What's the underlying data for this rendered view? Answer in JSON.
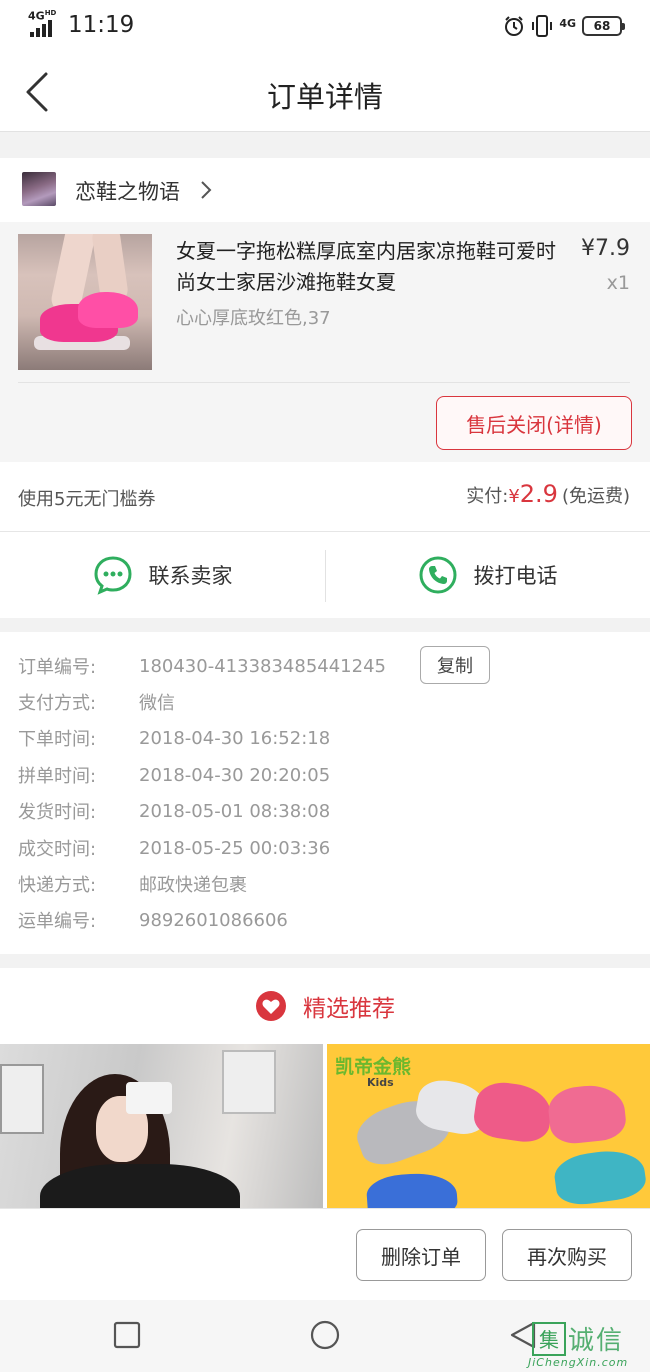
{
  "status_bar": {
    "network": "4G",
    "network_hd": "HD",
    "time": "11:19",
    "network_right": "4G",
    "battery": "68"
  },
  "nav": {
    "title": "订单详情"
  },
  "shop": {
    "name": "恋鞋之物语"
  },
  "product": {
    "title": "女夏一字拖松糕厚底室内居家凉拖鞋可爱时尚女士家居沙滩拖鞋女夏",
    "price": "¥7.9",
    "quantity": "x1",
    "spec": "心心厚底玫红色,37",
    "after_sale_label": "售后关闭(详情)"
  },
  "payment": {
    "coupon": "使用5元无门槛券",
    "paid_label": "实付:",
    "currency": "¥",
    "paid_amount": "2.9",
    "shipping_note": "(免运费)"
  },
  "contact": {
    "seller_label": "联系卖家",
    "phone_label": "拨打电话"
  },
  "order_info": {
    "copy_label": "复制",
    "rows": [
      {
        "label": "订单编号:",
        "value": "180430-413383485441245"
      },
      {
        "label": "支付方式:",
        "value": "微信"
      },
      {
        "label": "下单时间:",
        "value": "2018-04-30 16:52:18"
      },
      {
        "label": "拼单时间:",
        "value": "2018-04-30 20:20:05"
      },
      {
        "label": "发货时间:",
        "value": "2018-05-01 08:38:08"
      },
      {
        "label": "成交时间:",
        "value": "2018-05-25 00:03:36"
      },
      {
        "label": "快递方式:",
        "value": "邮政快递包裹"
      },
      {
        "label": "运单编号:",
        "value": "9892601086606"
      }
    ]
  },
  "recommend": {
    "title": "精选推荐",
    "item2_brand": "凯帝金熊",
    "item2_sub": "Kids"
  },
  "actions": {
    "delete_label": "删除订单",
    "rebuy_label": "再次购买"
  },
  "watermark": {
    "box": "集",
    "text": "诚信",
    "url": "JiChengXin.com"
  },
  "colors": {
    "accent": "#d9363e",
    "green": "#2fae5e"
  }
}
